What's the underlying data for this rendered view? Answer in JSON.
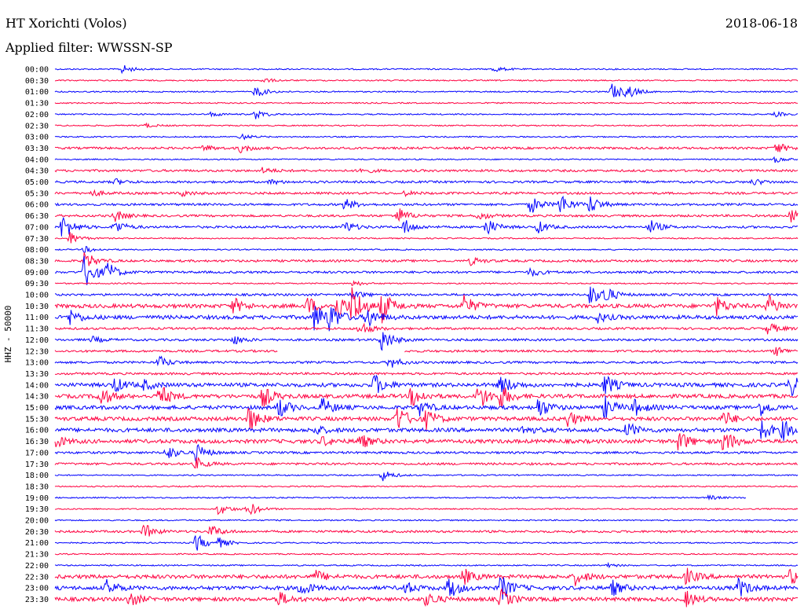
{
  "header": {
    "station": "HT Xorichti (Volos)",
    "date": "2018-06-18",
    "filter": "Applied filter: WWSSN-SP"
  },
  "channel_label": "HHZ - 50000",
  "colors": {
    "odd": "#0000ff",
    "even": "#ff0040",
    "text": "#000000"
  },
  "rows": [
    {
      "time": "00:00",
      "color": "blue",
      "activity": "low",
      "events": [
        {
          "x": 0.09,
          "amp": 6
        },
        {
          "x": 0.59,
          "amp": 4
        }
      ]
    },
    {
      "time": "00:30",
      "color": "red",
      "activity": "low",
      "events": [
        {
          "x": 0.28,
          "amp": 3
        }
      ]
    },
    {
      "time": "01:00",
      "color": "blue",
      "activity": "low",
      "events": [
        {
          "x": 0.27,
          "amp": 8
        },
        {
          "x": 0.75,
          "amp": 12
        },
        {
          "x": 0.77,
          "amp": 8
        }
      ]
    },
    {
      "time": "01:30",
      "color": "red",
      "activity": "low",
      "events": []
    },
    {
      "time": "02:00",
      "color": "blue",
      "activity": "low",
      "events": [
        {
          "x": 0.21,
          "amp": 3
        },
        {
          "x": 0.27,
          "amp": 6
        },
        {
          "x": 0.97,
          "amp": 3
        }
      ]
    },
    {
      "time": "02:30",
      "color": "red",
      "activity": "low",
      "events": [
        {
          "x": 0.12,
          "amp": 3
        }
      ]
    },
    {
      "time": "03:00",
      "color": "blue",
      "activity": "low",
      "events": [
        {
          "x": 0.25,
          "amp": 4
        }
      ]
    },
    {
      "time": "03:30",
      "color": "red",
      "activity": "medium",
      "events": [
        {
          "x": 0.2,
          "amp": 4
        },
        {
          "x": 0.25,
          "amp": 6
        },
        {
          "x": 0.97,
          "amp": 8
        }
      ]
    },
    {
      "time": "04:00",
      "color": "blue",
      "activity": "low",
      "events": [
        {
          "x": 0.97,
          "amp": 4
        }
      ]
    },
    {
      "time": "04:30",
      "color": "red",
      "activity": "medium",
      "events": [
        {
          "x": 0.28,
          "amp": 4
        },
        {
          "x": 0.41,
          "amp": 4
        }
      ]
    },
    {
      "time": "05:00",
      "color": "blue",
      "activity": "medium",
      "events": [
        {
          "x": 0.08,
          "amp": 4
        },
        {
          "x": 0.29,
          "amp": 3
        },
        {
          "x": 0.94,
          "amp": 4
        }
      ]
    },
    {
      "time": "05:30",
      "color": "red",
      "activity": "medium",
      "events": [
        {
          "x": 0.05,
          "amp": 4
        },
        {
          "x": 0.17,
          "amp": 4
        },
        {
          "x": 0.47,
          "amp": 3
        }
      ]
    },
    {
      "time": "06:00",
      "color": "blue",
      "activity": "medium",
      "events": [
        {
          "x": 0.39,
          "amp": 8
        },
        {
          "x": 0.64,
          "amp": 12
        },
        {
          "x": 0.68,
          "amp": 14
        },
        {
          "x": 0.72,
          "amp": 12
        }
      ]
    },
    {
      "time": "06:30",
      "color": "red",
      "activity": "medium",
      "events": [
        {
          "x": 0.08,
          "amp": 8
        },
        {
          "x": 0.46,
          "amp": 12
        },
        {
          "x": 0.57,
          "amp": 6
        },
        {
          "x": 0.99,
          "amp": 10
        }
      ]
    },
    {
      "time": "07:00",
      "color": "blue",
      "activity": "medium",
      "events": [
        {
          "x": 0.01,
          "amp": 18
        },
        {
          "x": 0.08,
          "amp": 10
        },
        {
          "x": 0.39,
          "amp": 8
        },
        {
          "x": 0.47,
          "amp": 10
        },
        {
          "x": 0.58,
          "amp": 12
        },
        {
          "x": 0.65,
          "amp": 8
        },
        {
          "x": 0.8,
          "amp": 10
        }
      ]
    },
    {
      "time": "07:30",
      "color": "red",
      "activity": "low",
      "events": [
        {
          "x": 0.02,
          "amp": 8
        }
      ]
    },
    {
      "time": "08:00",
      "color": "blue",
      "activity": "low",
      "events": [
        {
          "x": 0.04,
          "amp": 4
        }
      ]
    },
    {
      "time": "08:30",
      "color": "red",
      "activity": "medium",
      "events": [
        {
          "x": 0.04,
          "amp": 12
        },
        {
          "x": 0.56,
          "amp": 5
        }
      ]
    },
    {
      "time": "09:00",
      "color": "blue",
      "activity": "medium",
      "events": [
        {
          "x": 0.04,
          "amp": 24
        },
        {
          "x": 0.07,
          "amp": 12
        },
        {
          "x": 0.64,
          "amp": 6
        }
      ]
    },
    {
      "time": "09:30",
      "color": "red",
      "activity": "low",
      "events": [
        {
          "x": 0.4,
          "amp": 4
        }
      ]
    },
    {
      "time": "10:00",
      "color": "blue",
      "activity": "medium",
      "events": [
        {
          "x": 0.4,
          "amp": 6
        },
        {
          "x": 0.72,
          "amp": 14
        },
        {
          "x": 0.74,
          "amp": 10
        }
      ]
    },
    {
      "time": "10:30",
      "color": "red",
      "activity": "high",
      "events": [
        {
          "x": 0.24,
          "amp": 10
        },
        {
          "x": 0.34,
          "amp": 12
        },
        {
          "x": 0.38,
          "amp": 16
        },
        {
          "x": 0.4,
          "amp": 26
        },
        {
          "x": 0.44,
          "amp": 20
        },
        {
          "x": 0.55,
          "amp": 14
        },
        {
          "x": 0.89,
          "amp": 12
        },
        {
          "x": 0.96,
          "amp": 14
        }
      ]
    },
    {
      "time": "11:00",
      "color": "blue",
      "activity": "high",
      "events": [
        {
          "x": 0.02,
          "amp": 10
        },
        {
          "x": 0.35,
          "amp": 20
        },
        {
          "x": 0.37,
          "amp": 16
        },
        {
          "x": 0.42,
          "amp": 14
        },
        {
          "x": 0.73,
          "amp": 6
        }
      ]
    },
    {
      "time": "11:30",
      "color": "red",
      "activity": "medium",
      "events": [
        {
          "x": 0.41,
          "amp": 10
        },
        {
          "x": 0.96,
          "amp": 8
        }
      ]
    },
    {
      "time": "12:00",
      "color": "blue",
      "activity": "medium",
      "events": [
        {
          "x": 0.05,
          "amp": 4
        },
        {
          "x": 0.24,
          "amp": 6
        },
        {
          "x": 0.44,
          "amp": 16
        }
      ]
    },
    {
      "time": "12:30",
      "color": "red",
      "activity": "medium",
      "events": [
        {
          "x": 0.97,
          "amp": 6
        }
      ],
      "gap": [
        0.3,
        0.47
      ]
    },
    {
      "time": "13:00",
      "color": "blue",
      "activity": "medium",
      "events": [
        {
          "x": 0.14,
          "amp": 8
        },
        {
          "x": 0.45,
          "amp": 8
        }
      ]
    },
    {
      "time": "13:30",
      "color": "red",
      "activity": "medium",
      "events": []
    },
    {
      "time": "14:00",
      "color": "blue",
      "activity": "high",
      "events": [
        {
          "x": 0.08,
          "amp": 10
        },
        {
          "x": 0.12,
          "amp": 6
        },
        {
          "x": 0.43,
          "amp": 14
        },
        {
          "x": 0.6,
          "amp": 14
        },
        {
          "x": 0.74,
          "amp": 14
        },
        {
          "x": 0.99,
          "amp": 14
        }
      ]
    },
    {
      "time": "14:30",
      "color": "red",
      "activity": "high",
      "events": [
        {
          "x": 0.06,
          "amp": 14
        },
        {
          "x": 0.14,
          "amp": 16
        },
        {
          "x": 0.28,
          "amp": 14
        },
        {
          "x": 0.48,
          "amp": 14
        },
        {
          "x": 0.57,
          "amp": 18
        },
        {
          "x": 0.6,
          "amp": 14
        }
      ]
    },
    {
      "time": "15:00",
      "color": "blue",
      "activity": "high",
      "events": [
        {
          "x": 0.3,
          "amp": 14
        },
        {
          "x": 0.36,
          "amp": 12
        },
        {
          "x": 0.49,
          "amp": 10
        },
        {
          "x": 0.65,
          "amp": 14
        },
        {
          "x": 0.74,
          "amp": 14
        },
        {
          "x": 0.78,
          "amp": 10
        },
        {
          "x": 0.95,
          "amp": 10
        }
      ]
    },
    {
      "time": "15:30",
      "color": "red",
      "activity": "high",
      "events": [
        {
          "x": 0.26,
          "amp": 18
        },
        {
          "x": 0.46,
          "amp": 18
        },
        {
          "x": 0.5,
          "amp": 12
        },
        {
          "x": 0.69,
          "amp": 10
        },
        {
          "x": 0.9,
          "amp": 10
        }
      ]
    },
    {
      "time": "16:00",
      "color": "blue",
      "activity": "high",
      "events": [
        {
          "x": 0.35,
          "amp": 6
        },
        {
          "x": 0.63,
          "amp": 6
        },
        {
          "x": 0.77,
          "amp": 10
        },
        {
          "x": 0.95,
          "amp": 14
        },
        {
          "x": 0.98,
          "amp": 12
        }
      ]
    },
    {
      "time": "16:30",
      "color": "red",
      "activity": "high",
      "events": [
        {
          "x": 0.0,
          "amp": 8
        },
        {
          "x": 0.36,
          "amp": 6
        },
        {
          "x": 0.41,
          "amp": 10
        },
        {
          "x": 0.84,
          "amp": 14
        },
        {
          "x": 0.9,
          "amp": 16
        }
      ]
    },
    {
      "time": "17:00",
      "color": "blue",
      "activity": "medium",
      "events": [
        {
          "x": 0.15,
          "amp": 10
        },
        {
          "x": 0.19,
          "amp": 12
        }
      ]
    },
    {
      "time": "17:30",
      "color": "red",
      "activity": "medium",
      "events": [
        {
          "x": 0.19,
          "amp": 8
        }
      ]
    },
    {
      "time": "18:00",
      "color": "blue",
      "activity": "low",
      "events": [
        {
          "x": 0.44,
          "amp": 8
        }
      ]
    },
    {
      "time": "18:30",
      "color": "red",
      "activity": "low",
      "events": []
    },
    {
      "time": "19:00",
      "color": "blue",
      "activity": "low",
      "events": [
        {
          "x": 0.88,
          "amp": 3
        }
      ],
      "end": 0.93
    },
    {
      "time": "19:30",
      "color": "red",
      "activity": "low",
      "events": [
        {
          "x": 0.22,
          "amp": 8
        },
        {
          "x": 0.26,
          "amp": 10
        }
      ]
    },
    {
      "time": "20:00",
      "color": "blue",
      "activity": "low",
      "events": []
    },
    {
      "time": "20:30",
      "color": "red",
      "activity": "medium",
      "events": [
        {
          "x": 0.12,
          "amp": 10
        },
        {
          "x": 0.21,
          "amp": 8
        }
      ]
    },
    {
      "time": "21:00",
      "color": "blue",
      "activity": "low",
      "events": [
        {
          "x": 0.19,
          "amp": 12
        },
        {
          "x": 0.22,
          "amp": 6
        }
      ]
    },
    {
      "time": "21:30",
      "color": "red",
      "activity": "low",
      "events": []
    },
    {
      "time": "22:00",
      "color": "blue",
      "activity": "low",
      "events": [
        {
          "x": 0.74,
          "amp": 3
        }
      ]
    },
    {
      "time": "22:30",
      "color": "red",
      "activity": "high",
      "events": [
        {
          "x": 0.35,
          "amp": 8
        },
        {
          "x": 0.55,
          "amp": 10
        },
        {
          "x": 0.7,
          "amp": 10
        },
        {
          "x": 0.85,
          "amp": 10
        },
        {
          "x": 0.99,
          "amp": 10
        }
      ]
    },
    {
      "time": "23:00",
      "color": "blue",
      "activity": "high",
      "events": [
        {
          "x": 0.07,
          "amp": 10
        },
        {
          "x": 0.33,
          "amp": 10
        },
        {
          "x": 0.47,
          "amp": 8
        },
        {
          "x": 0.53,
          "amp": 14
        },
        {
          "x": 0.6,
          "amp": 18
        },
        {
          "x": 0.75,
          "amp": 10
        },
        {
          "x": 0.92,
          "amp": 12
        }
      ]
    },
    {
      "time": "23:30",
      "color": "red",
      "activity": "high",
      "events": [
        {
          "x": 0.1,
          "amp": 10
        },
        {
          "x": 0.3,
          "amp": 10
        },
        {
          "x": 0.5,
          "amp": 10
        },
        {
          "x": 0.6,
          "amp": 12
        },
        {
          "x": 0.85,
          "amp": 10
        }
      ]
    }
  ]
}
